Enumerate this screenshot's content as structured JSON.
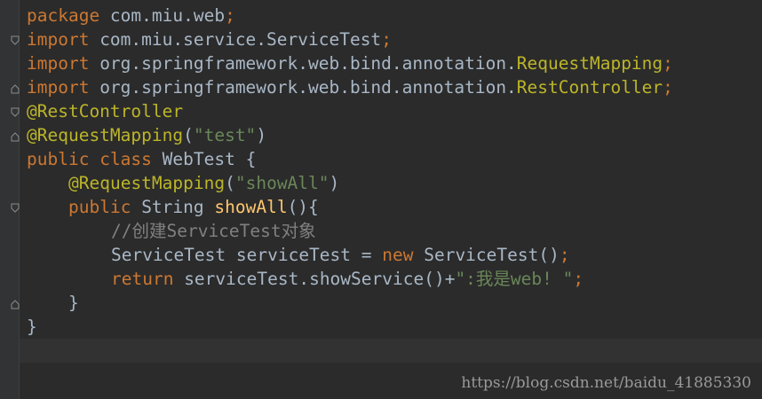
{
  "code": {
    "l1": {
      "kw": "package",
      "rest": " com.miu.web",
      "semi": ";"
    },
    "l2": {
      "kw": "import",
      "rest": " com.miu.service.ServiceTest",
      "semi": ";"
    },
    "l3": {
      "kw": "import",
      "rest": " org.springframework.web.bind.annotation.",
      "ann": "RequestMapping",
      "semi": ";"
    },
    "l4": {
      "kw": "import",
      "rest": " org.springframework.web.bind.annotation.",
      "ann": "RestController",
      "semi": ";"
    },
    "l5": {
      "ann": "@RestController"
    },
    "l6": {
      "ann": "@RequestMapping",
      "open": "(",
      "str": "\"test\"",
      "close": ")"
    },
    "l7": {
      "kw1": "public",
      "kw2": "class",
      "rest": " WebTest {"
    },
    "l8": {
      "ann": "@RequestMapping",
      "open": "(",
      "str": "\"showAll\"",
      "close": ")"
    },
    "l9": {
      "kw": "public",
      "type": " String ",
      "fn": "showAll",
      "rest": "(){"
    },
    "l10": {
      "comment": "//创建ServiceTest对象"
    },
    "l11": {
      "rest": "ServiceTest serviceTest = ",
      "kw": "new",
      "rest2": " ServiceTest()",
      "semi": ";"
    },
    "l12": {
      "kw": "return",
      "rest": " serviceTest.showService()+",
      "str": "\":我是web! \"",
      "semi": ";"
    },
    "l13": {
      "rest": "}"
    },
    "l14": {
      "rest": "}"
    }
  },
  "watermark": "https://blog.csdn.net/baidu_41885330",
  "colors": {
    "background": "#2b2b2b",
    "keyword": "#cc7832",
    "annotation": "#bbb529",
    "string": "#6a8759",
    "comment": "#808080",
    "function": "#ffc66d",
    "text": "#a9b7c6"
  }
}
